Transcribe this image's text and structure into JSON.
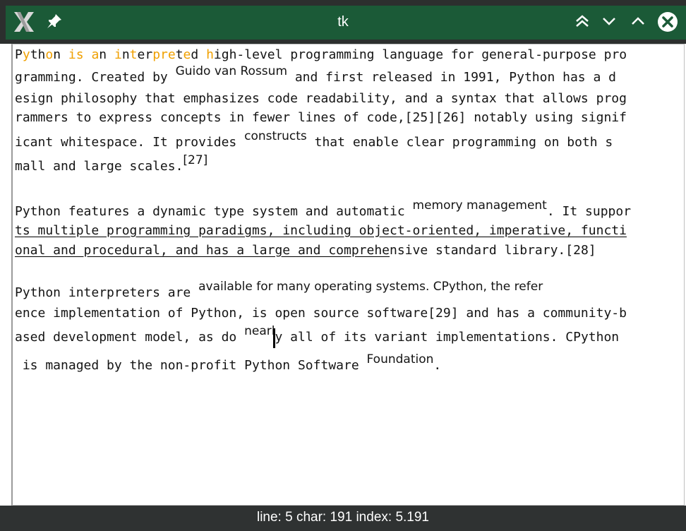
{
  "window": {
    "title": "tk",
    "icons": {
      "app": "x-logo-icon",
      "pin": "pin-icon",
      "shade": "double-chevron-up-icon",
      "minimize": "chevron-down-icon",
      "maximize": "chevron-up-icon",
      "close": "close-icon"
    }
  },
  "text": {
    "highlight_color": "#f0a000",
    "underline_color": "#000000",
    "lines": [
      {
        "parts": [
          {
            "t": "P"
          },
          {
            "t": "y",
            "hl": true
          },
          {
            "t": "th"
          },
          {
            "t": "o",
            "hl": true
          },
          {
            "t": "n "
          },
          {
            "t": "is",
            "hl": true
          },
          {
            "t": " "
          },
          {
            "t": "a",
            "hl": true
          },
          {
            "t": "n "
          },
          {
            "t": "i",
            "hl": true
          },
          {
            "t": "n"
          },
          {
            "t": "t",
            "hl": true
          },
          {
            "t": "er"
          },
          {
            "t": "pre",
            "hl": true
          },
          {
            "t": "t"
          },
          {
            "t": "e",
            "hl": true
          },
          {
            "t": "d "
          },
          {
            "t": "h",
            "hl": true
          },
          {
            "t": "igh-level programming language for general-purpose pro"
          }
        ]
      },
      {
        "parts": [
          {
            "t": "gramming. Created by "
          },
          {
            "t": "Guido van Rossum",
            "sup": true
          },
          {
            "t": " and first released in 1991, Python has a d"
          }
        ]
      },
      {
        "parts": [
          {
            "t": "esign philosophy that emphasizes code readability, and a syntax that allows prog"
          }
        ]
      },
      {
        "parts": [
          {
            "t": "rammers to express concepts in fewer lines of code,[25][26] notably using signif"
          }
        ]
      },
      {
        "parts": [
          {
            "t": "icant whitespace. It provides "
          },
          {
            "t": "constructs",
            "sup": true
          },
          {
            "t": " that enable clear programming on both s"
          }
        ]
      },
      {
        "parts": [
          {
            "t": "mall and large scales."
          },
          {
            "t": "[27]",
            "sup": true
          }
        ]
      },
      {
        "parts": [
          {
            "t": "Python features a dynamic type system and automatic "
          },
          {
            "t": "memory management",
            "sup": true
          },
          {
            "t": ". It suppor"
          }
        ]
      },
      {
        "parts": [
          {
            "t": "ts multiple programming paradigms, including object-oriented, imperative, functi",
            "ul": true
          }
        ]
      },
      {
        "parts": [
          {
            "t": "onal and procedural, and has a large and comprehe",
            "ul": true
          },
          {
            "t": "nsive standard library.[28]"
          }
        ]
      },
      {
        "parts": [
          {
            "t": "Python interpreters are "
          },
          {
            "t": "available for many operating systems. CPython, the refer",
            "sup": true
          }
        ]
      },
      {
        "parts": [
          {
            "t": "ence implementation of Python, is open source software[29] and has a community-b"
          }
        ]
      },
      {
        "parts": [
          {
            "t": "ased development model, as do "
          },
          {
            "t": "nearl",
            "sup": true
          },
          {
            "t": "y all of its variant implementations. CPython"
          }
        ]
      },
      {
        "parts": [
          {
            "t": " is managed by the non-profit Python Software "
          },
          {
            "t": "Foundation",
            "sup": true
          },
          {
            "t": "."
          }
        ]
      }
    ]
  },
  "status": {
    "text": "line: 5 char: 191 index: 5.191"
  }
}
